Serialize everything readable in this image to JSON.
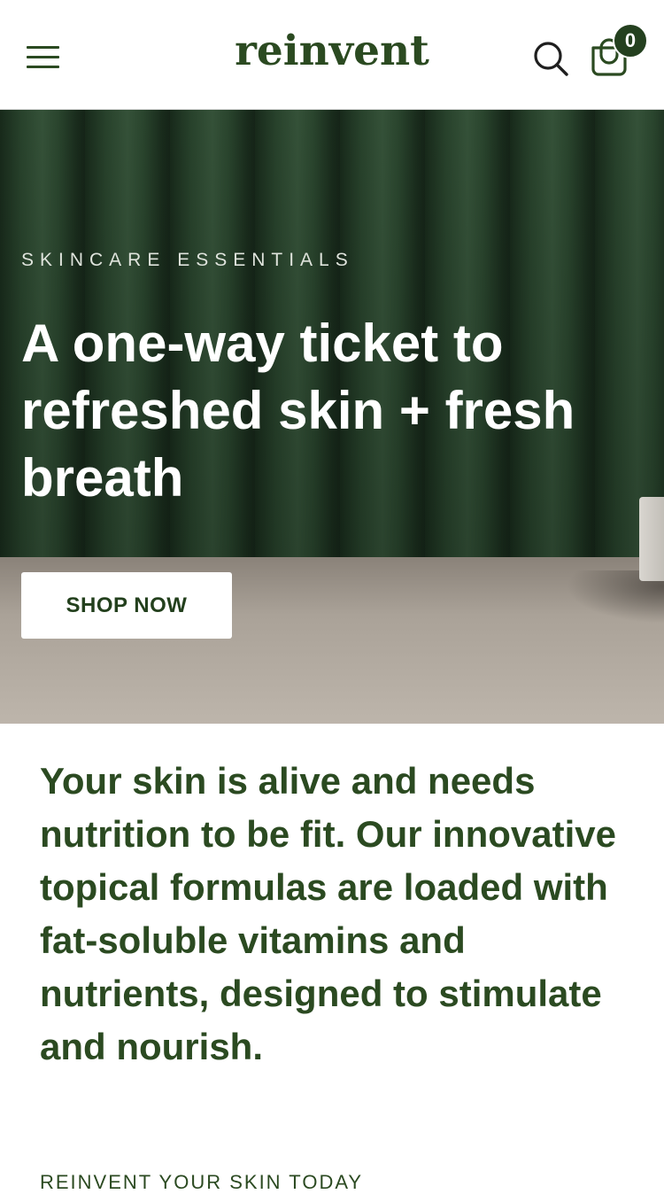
{
  "header": {
    "logo": "reinvent",
    "menu_icon": "hamburger-menu-icon",
    "search_icon": "search-icon",
    "cart_icon": "shopping-bag-icon",
    "cart_count": "0"
  },
  "hero": {
    "eyebrow": "SKINCARE ESSENTIALS",
    "headline": "A one-way ticket to refreshed skin + fresh breath",
    "cta_label": "SHOP NOW"
  },
  "intro": {
    "text": "Your skin is alive and needs nutrition to be fit. Our innovative topical formulas are loaded with fat-soluble vitamins and nutrients, designed to stimulate and nourish."
  },
  "section": {
    "subheading": "REINVENT YOUR SKIN TODAY"
  },
  "colors": {
    "brand_green": "#2b4a21",
    "badge_green": "#24401f",
    "white": "#ffffff"
  }
}
